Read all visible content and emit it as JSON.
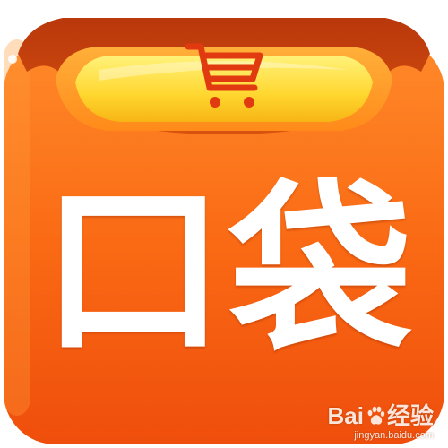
{
  "app_icon": {
    "label": "口袋",
    "colors": {
      "body_top": "#ff7a1e",
      "body_bottom": "#f04a0a",
      "flap": "#c8420e",
      "pocket_yellow": "#ffe45a",
      "cart": "#e23a10"
    },
    "icon_name": "shopping-cart-icon"
  },
  "watermark": {
    "brand": "Bai经验",
    "brand_prefix": "Bai",
    "brand_suffix": "经验",
    "url": "jingyan.baidu.com"
  }
}
